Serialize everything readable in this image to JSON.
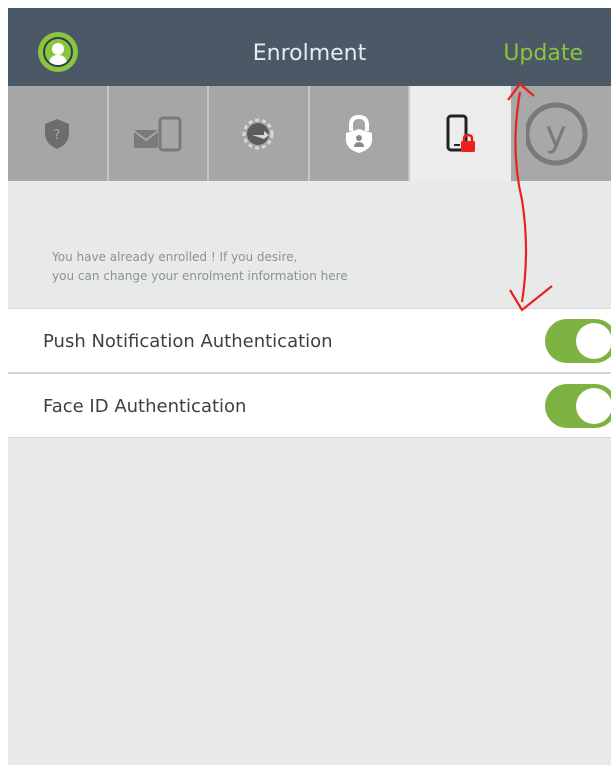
{
  "header": {
    "title": "Enrolment",
    "update_label": "Update"
  },
  "tabs": [
    {
      "icon": "shield-question-icon",
      "active": false
    },
    {
      "icon": "devices-icon",
      "active": false
    },
    {
      "icon": "key-sync-icon",
      "active": false
    },
    {
      "icon": "lock-user-icon",
      "active": false
    },
    {
      "icon": "phone-lock-icon",
      "active": true
    },
    {
      "icon": "y-logo-icon",
      "active": false
    }
  ],
  "message": {
    "line1": "You have already enrolled ! If you desire,",
    "line2": "you can change your enrolment information here"
  },
  "settings": [
    {
      "label": "Push Notification Authentication",
      "enabled": true
    },
    {
      "label": "Face ID Authentication",
      "enabled": true
    }
  ],
  "colors": {
    "header_bg": "#4a5965",
    "accent_green": "#8bc53f",
    "toggle_on": "#7cb342",
    "tab_bg": "#a6a6a6",
    "annotation_red": "#e8231b"
  }
}
